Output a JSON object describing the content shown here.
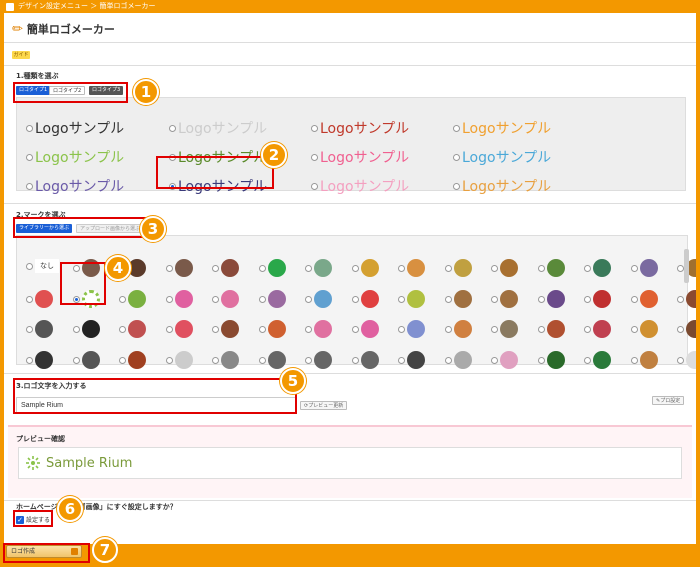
{
  "topbar": {
    "breadcrumb": "デザイン設定メニュー ＞ 簡単ロゴメーカー"
  },
  "title": "簡単ロゴメーカー",
  "guide": "ガイド",
  "section1": {
    "label": "1.種類を選ぶ",
    "tabs": [
      "ロゴタイプ1",
      "ロゴタイプ2",
      "ロゴタイプ3"
    ],
    "logo_text": "Logoサンプル",
    "rows": [
      [
        "#333333",
        "#cccccc",
        "#c0392b",
        "#f0a030"
      ],
      [
        "#8bc34a",
        "#5a8a2a",
        "#f06090",
        "#4aa8d8"
      ],
      [
        "#6a5aa8",
        "#3a3a7a",
        "#f4a0c0",
        "#e8a040"
      ]
    ]
  },
  "section2": {
    "label": "2.マークを選ぶ",
    "btn_library": "ライブラリーから選ぶ",
    "btn_upload": "アップロード画像から選ぶ",
    "none_label": "なし"
  },
  "section3": {
    "label": "3.ロゴ文字を入力する",
    "input_value": "Sample Rium",
    "preview_update": "プレビュー更新",
    "pro_settings": "プロ設定"
  },
  "preview": {
    "label": "プレビュー確認",
    "text": "Sample Rium"
  },
  "homepage": {
    "question": "ホームページの「ロゴ画像」にすぐ設定しますか？",
    "checkbox_label": "設定する"
  },
  "create_button": "ロゴ作成",
  "callouts": [
    "1",
    "2",
    "3",
    "4",
    "5",
    "6",
    "7"
  ],
  "colors": {
    "accent": "#f39800",
    "highlight": "#e00000",
    "selected_blue": "#1a5fd6"
  }
}
